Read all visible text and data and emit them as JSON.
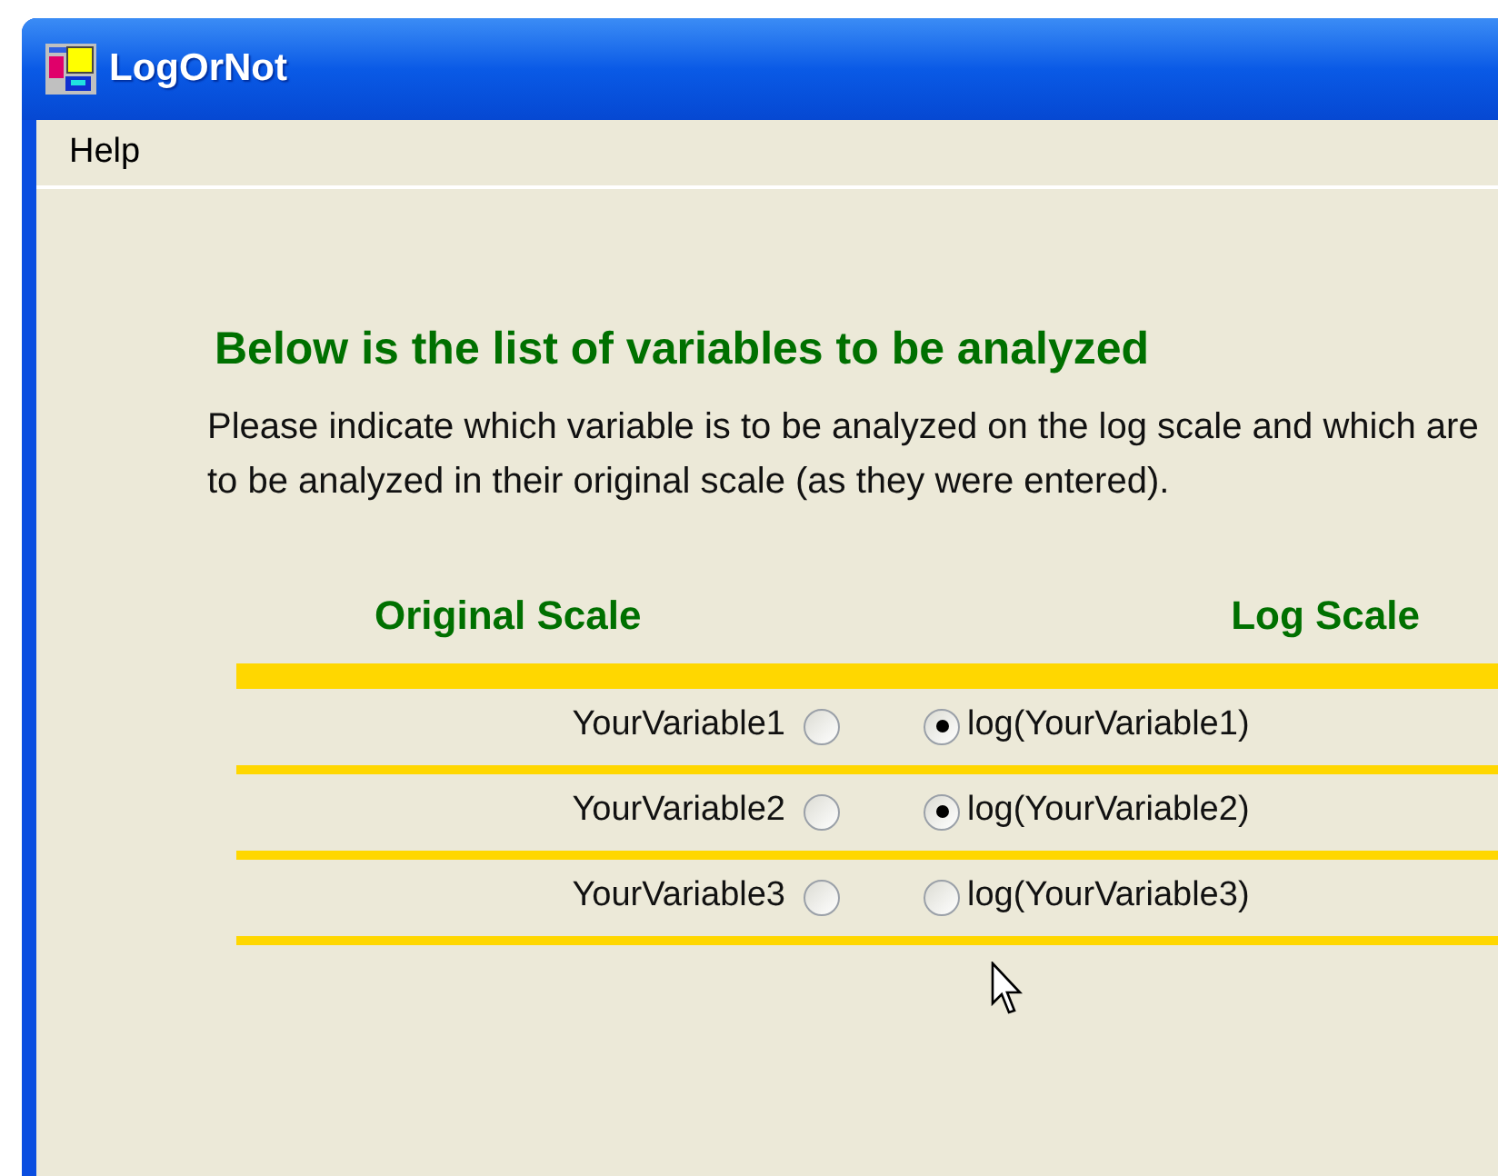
{
  "window": {
    "title": "LogOrNot"
  },
  "menu": [
    {
      "label": "Help"
    }
  ],
  "heading": "Below is the list of variables to be analyzed",
  "instructions": "Please indicate which variable is to be analyzed on the log scale and which are to be analyzed in their original scale (as they were entered).",
  "columns": {
    "original": "Original Scale",
    "log": "Log Scale"
  },
  "rows": [
    {
      "original": {
        "label": "YourVariable1",
        "selected": false
      },
      "log": {
        "label": "log(YourVariable1)",
        "selected": true
      }
    },
    {
      "original": {
        "label": "YourVariable2",
        "selected": false
      },
      "log": {
        "label": "log(YourVariable2)",
        "selected": true
      }
    },
    {
      "original": {
        "label": "YourVariable3",
        "selected": false
      },
      "log": {
        "label": "log(YourVariable3)",
        "selected": false
      }
    }
  ]
}
